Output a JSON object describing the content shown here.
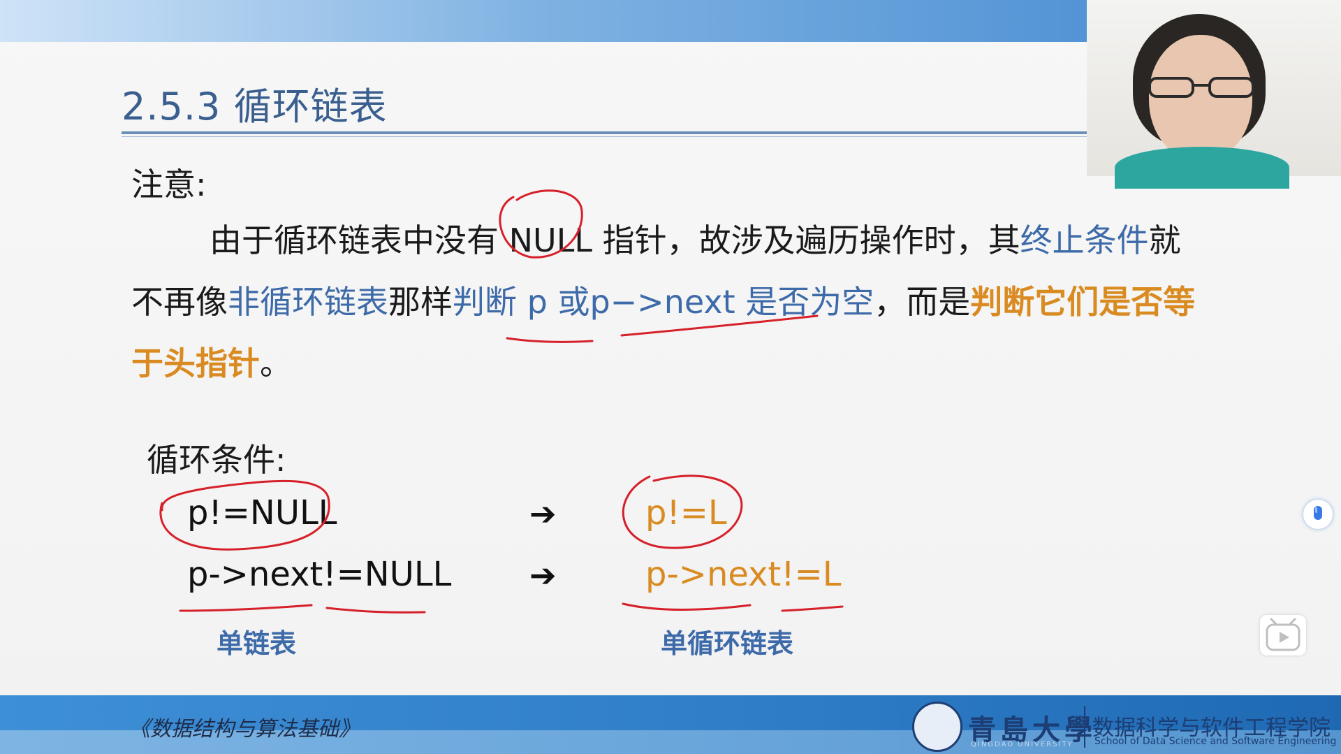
{
  "slide": {
    "title": "2.5.3 循环链表",
    "note_label": "注意:",
    "paragraph": {
      "p1": "由于循环链表中没有 NULL 指针，故涉及遍历操作时，其",
      "p2_blue": "终止条件",
      "p3": "就不再像",
      "p4_blue": "非循环链表",
      "p5": "那样",
      "p6_blue": "判断 p 或p−>next 是否为空",
      "p7": "，而是",
      "p8_orange": "判断它们是否等于头指针",
      "p9": "。"
    },
    "cond_label": "循环条件:",
    "rows": [
      {
        "left": "p!=NULL",
        "arrow": "➔",
        "right": "p!=L"
      },
      {
        "left": "p->next!=NULL",
        "arrow": "➔",
        "right": "p->next!=L"
      }
    ],
    "caption_left": "单链表",
    "caption_right": "单循环链表"
  },
  "footer": {
    "book_title": "《数据结构与算法基础》",
    "university_cn": "青島大學",
    "university_en": "QINGDAO UNIVERSITY",
    "school_cn": "数据科学与软件工程学院",
    "school_en": "School of Data Science and Software Engineering"
  },
  "colors": {
    "title_blue": "#3a5f8f",
    "text_blue": "#3d6aa8",
    "accent_orange": "#d98b22",
    "ink_red": "#d6202a",
    "banner_blue": "#2e7cc6"
  },
  "icons": {
    "mic": "microphone-icon",
    "play": "play-icon",
    "arrow": "right-arrow-icon"
  }
}
